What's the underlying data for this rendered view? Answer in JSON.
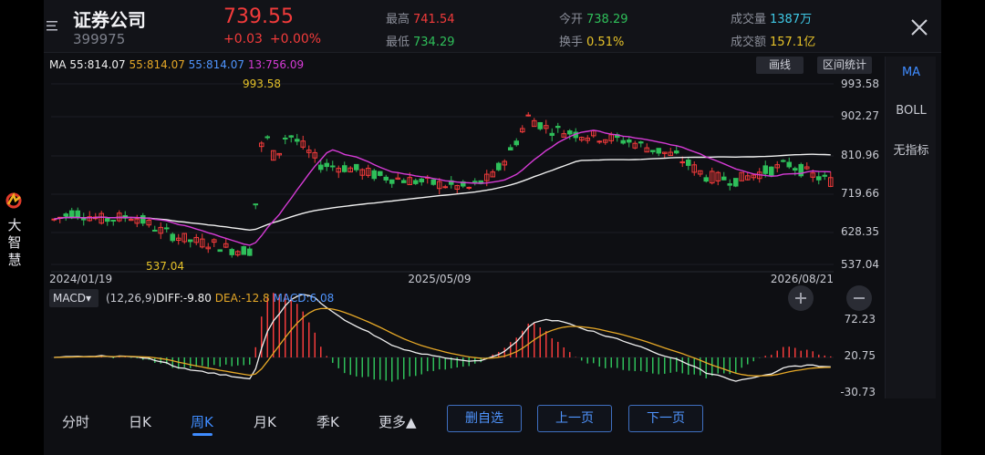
{
  "rail": {
    "text": "大\n智\n慧"
  },
  "header": {
    "stock_name": "证券公司",
    "stock_code": "399975",
    "price": "739.55",
    "change": "+0.03",
    "change_pct": "+0.00%",
    "stats": [
      {
        "label": "最高",
        "value": "741.54",
        "color": "#f23b3b"
      },
      {
        "label": "最低",
        "value": "734.29",
        "color": "#2fbf5a"
      },
      {
        "label": "今开",
        "value": "738.29",
        "color": "#2fbf5a"
      },
      {
        "label": "换手",
        "value": "0.51%",
        "color": "#e6c229"
      },
      {
        "label": "成交量",
        "value": "1387万",
        "color": "#3fc9e6"
      },
      {
        "label": "成交额",
        "value": "157.1亿",
        "color": "#e6c229"
      }
    ]
  },
  "ma_legend": {
    "ma": "MA",
    "v1": "55:814.07",
    "v2": "55:814.07",
    "v3": "55:814.07",
    "v4": "13:756.09"
  },
  "tools": {
    "draw": "画线",
    "range_stats": "区间统计"
  },
  "side_panel": [
    "MA",
    "BOLL",
    "无指标"
  ],
  "price_axis": [
    "993.58",
    "902.27",
    "810.96",
    "719.66",
    "628.35",
    "537.04"
  ],
  "annotations": {
    "high": "993.58",
    "low": "537.04"
  },
  "dates": [
    "2024/01/19",
    "2025/05/09",
    "2026/08/21"
  ],
  "macd": {
    "selector": "MACD▾",
    "params": "(12,26,9)",
    "diff": "DIFF:-9.80",
    "dea": "DEA:-12.8",
    "macd": "MACD:6.08",
    "axis": [
      "72.23",
      "20.75",
      "-30.73"
    ]
  },
  "colors": {
    "up": "#f23b3b",
    "down": "#2fbf5a",
    "ma_white": "#f0f0f0",
    "ma_magenta": "#d63bd6",
    "dea": "#e6a827",
    "accent": "#3f8cff"
  },
  "tabs": [
    "分时",
    "日K",
    "周K",
    "月K",
    "季K",
    "更多▲"
  ],
  "actions": [
    "删自选",
    "上一页",
    "下一页"
  ]
}
